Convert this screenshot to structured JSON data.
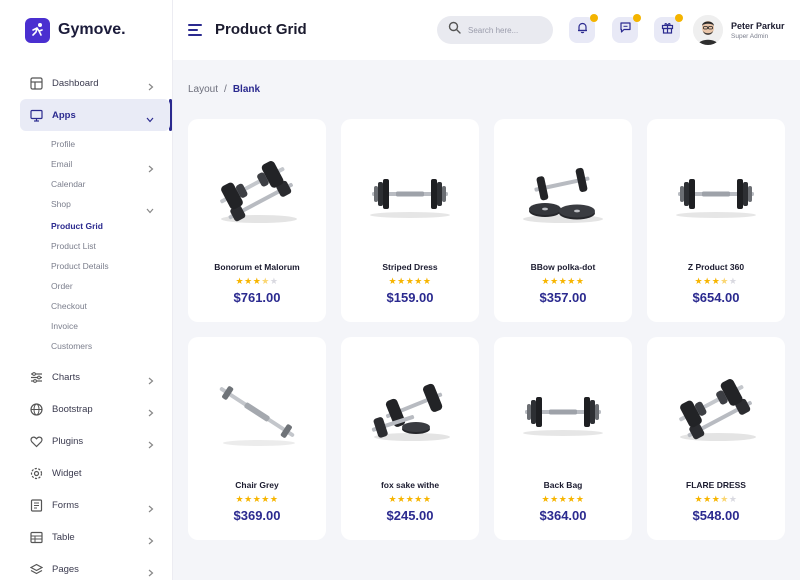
{
  "brand": {
    "name": "Gymove.",
    "color": "#4a2fd0"
  },
  "header": {
    "title": "Product Grid",
    "search_placeholder": "Search here...",
    "user_name": "Peter Parkur",
    "user_role": "Super Admin",
    "notification_dot_color": "#f4b400"
  },
  "sidebar": {
    "items": [
      {
        "label": "Dashboard",
        "icon": "dashboard-icon",
        "has_chevron": true
      },
      {
        "label": "Apps",
        "icon": "monitor-icon",
        "has_chevron": true,
        "expanded": true,
        "active": true
      },
      {
        "label": "Charts",
        "icon": "sliders-icon",
        "has_chevron": true
      },
      {
        "label": "Bootstrap",
        "icon": "globe-icon",
        "has_chevron": true
      },
      {
        "label": "Plugins",
        "icon": "heart-icon",
        "has_chevron": true
      },
      {
        "label": "Widget",
        "icon": "settings-icon",
        "has_chevron": false
      },
      {
        "label": "Forms",
        "icon": "form-icon",
        "has_chevron": true
      },
      {
        "label": "Table",
        "icon": "table-icon",
        "has_chevron": true
      },
      {
        "label": "Pages",
        "icon": "layers-icon",
        "has_chevron": true
      }
    ],
    "apps_submenu": [
      {
        "label": "Profile"
      },
      {
        "label": "Email",
        "has_chevron": true
      },
      {
        "label": "Calendar"
      },
      {
        "label": "Shop",
        "has_chevron": true,
        "expanded": true
      },
      {
        "label": "Product Grid",
        "current": true
      },
      {
        "label": "Product List"
      },
      {
        "label": "Product Details"
      },
      {
        "label": "Order"
      },
      {
        "label": "Checkout"
      },
      {
        "label": "Invoice"
      },
      {
        "label": "Customers"
      }
    ]
  },
  "breadcrumb": {
    "root": "Layout",
    "separator": "/",
    "current": "Blank"
  },
  "products": [
    {
      "name": "Bonorum et Malorum",
      "price": "$761.00",
      "rating": 3.5,
      "image": "dumbbell-stack-icon"
    },
    {
      "name": "Striped Dress",
      "price": "$159.00",
      "rating": 5,
      "image": "dumbbell-icon"
    },
    {
      "name": "BBow polka-dot",
      "price": "$357.00",
      "rating": 5,
      "image": "dumbbell-plates-icon"
    },
    {
      "name": "Z Product 360",
      "price": "$654.00",
      "rating": 3.5,
      "image": "dumbbell-icon"
    },
    {
      "name": "Chair Grey",
      "price": "$369.00",
      "rating": 5,
      "image": "dumbbell-bar-icon"
    },
    {
      "name": "fox sake withe",
      "price": "$245.00",
      "rating": 5,
      "image": "dumbbell-pair-icon"
    },
    {
      "name": "Back Bag",
      "price": "$364.00",
      "rating": 5,
      "image": "dumbbell-icon"
    },
    {
      "name": "FLARE DRESS",
      "price": "$548.00",
      "rating": 3.5,
      "image": "dumbbell-stack-icon"
    }
  ],
  "colors": {
    "accent": "#2b2a8f",
    "star": "#f7b500",
    "background": "#f4f5f9"
  }
}
